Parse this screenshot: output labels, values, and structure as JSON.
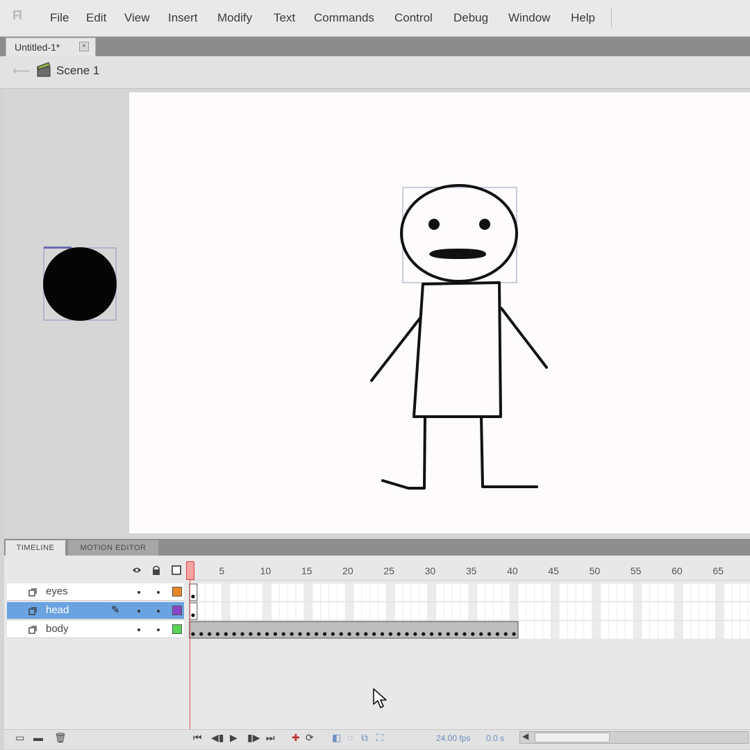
{
  "menu": {
    "items": [
      "File",
      "Edit",
      "View",
      "Insert",
      "Modify",
      "Text",
      "Commands",
      "Control",
      "Debug",
      "Window",
      "Help"
    ]
  },
  "document_tab": {
    "label": "Untitled-1*",
    "close_glyph": "×"
  },
  "edit_bar": {
    "scene_label": "Scene 1"
  },
  "timeline": {
    "tabs": [
      "TIMELINE",
      "MOTION EDITOR"
    ],
    "ruler": [
      "5",
      "10",
      "15",
      "20",
      "25",
      "30",
      "35",
      "40",
      "45",
      "50",
      "55",
      "60",
      "65"
    ],
    "current_frame": 1,
    "layers": [
      {
        "name": "eyes",
        "color": "#e8862a",
        "selected": false,
        "frames": 1
      },
      {
        "name": "head",
        "color": "#8a44c8",
        "selected": true,
        "frames": 1
      },
      {
        "name": "body",
        "color": "#55d455",
        "selected": false,
        "frames": 40
      }
    ],
    "fps": "24.00 fps",
    "time": "0.0 s"
  },
  "colors": {
    "selection": "#6aa3e0",
    "playhead": "#e05050",
    "stage": "#fdfbfb"
  }
}
